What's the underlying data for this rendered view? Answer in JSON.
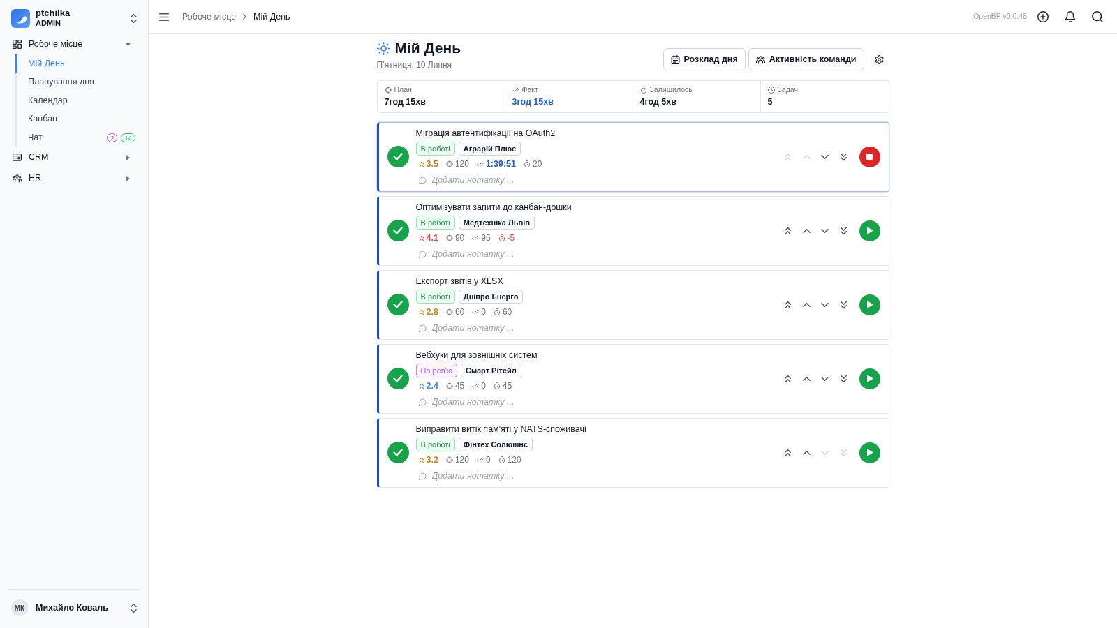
{
  "sidebar": {
    "workspace": {
      "name": "ptchilka",
      "role": "ADMIN"
    },
    "nav": [
      {
        "label": "Робоче місце",
        "expanded": true,
        "children": [
          {
            "label": "Мій День",
            "selected": true
          },
          {
            "label": "Планування дня",
            "selected": false
          },
          {
            "label": "Календар",
            "selected": false
          },
          {
            "label": "Канбан",
            "selected": false
          },
          {
            "label": "Чат",
            "selected": false,
            "badges": [
              {
                "text": "2",
                "color": "#a855f7"
              },
              {
                "text": "14",
                "color": "#22c55e"
              }
            ]
          }
        ]
      },
      {
        "label": "CRM",
        "expanded": false
      },
      {
        "label": "HR",
        "expanded": false
      }
    ],
    "user": {
      "initials": "МК",
      "name": "Михайло Коваль"
    }
  },
  "header": {
    "breadcrumbs": [
      "Робоче місце",
      "Мій День"
    ],
    "version": "OpenBP v0.0.48"
  },
  "page": {
    "title": "Мій День",
    "date": "П’ятниця, 10 Липня",
    "buttons": [
      "Розклад дня",
      "Активність команди"
    ]
  },
  "stats": [
    {
      "label": "План",
      "value": "7год 15хв",
      "color": "#111827"
    },
    {
      "label": "Факт",
      "value": "3год 15хв",
      "color": "#1d5fd6"
    },
    {
      "label": "Залишилось",
      "value": "4год 5хв",
      "color": "#111827"
    },
    {
      "label": "Задач",
      "value": "5",
      "color": "#111827"
    }
  ],
  "tasks": [
    {
      "title": "Міграція автентифікації на OAuth2",
      "selected": true,
      "status": {
        "label": "В роботі",
        "kind": "in_progress"
      },
      "client": "Аграрій Плюс",
      "priority": {
        "value": "3.5",
        "color": "#d4860b"
      },
      "plan": "120",
      "fact": "1:39:51",
      "remaining": "20",
      "overdue": false,
      "placeholder": "Додати нотатку ...",
      "running": true,
      "up_disabled": true,
      "down_disabled": false
    },
    {
      "title": "Оптимізувати запити до канбан-дошки",
      "selected": false,
      "status": {
        "label": "В роботі",
        "kind": "in_progress"
      },
      "client": "Медтехніка Львів",
      "priority": {
        "value": "4.1",
        "color": "#ef4444"
      },
      "plan": "90",
      "fact": "95",
      "remaining": "-5",
      "overdue": true,
      "placeholder": "Додати нотатку ...",
      "running": false,
      "up_disabled": false,
      "down_disabled": false
    },
    {
      "title": "Експорт звітів у XLSX",
      "selected": false,
      "status": {
        "label": "В роботі",
        "kind": "in_progress"
      },
      "client": "Дніпро Енерго",
      "priority": {
        "value": "2.8",
        "color": "#d4860b"
      },
      "plan": "60",
      "fact": "0",
      "remaining": "60",
      "overdue": false,
      "placeholder": "Додати нотатку ...",
      "running": false,
      "up_disabled": false,
      "down_disabled": false
    },
    {
      "title": "Вебхуки для зовнішніх систем",
      "selected": false,
      "status": {
        "label": "На рев'ю",
        "kind": "review"
      },
      "client": "Смарт Рітейл",
      "priority": {
        "value": "2.4",
        "color": "#3b82f6"
      },
      "plan": "45",
      "fact": "0",
      "remaining": "45",
      "overdue": false,
      "placeholder": "Додати нотатку ...",
      "running": false,
      "up_disabled": false,
      "down_disabled": false
    },
    {
      "title": "Виправити витік пам'яті у NATS-споживачі",
      "selected": false,
      "status": {
        "label": "В роботі",
        "kind": "in_progress"
      },
      "client": "Фінтех Солюшнс",
      "priority": {
        "value": "3.2",
        "color": "#d4860b"
      },
      "plan": "120",
      "fact": "0",
      "remaining": "120",
      "overdue": false,
      "placeholder": "Додати нотатку ...",
      "running": false,
      "up_disabled": false,
      "down_disabled": true
    }
  ]
}
